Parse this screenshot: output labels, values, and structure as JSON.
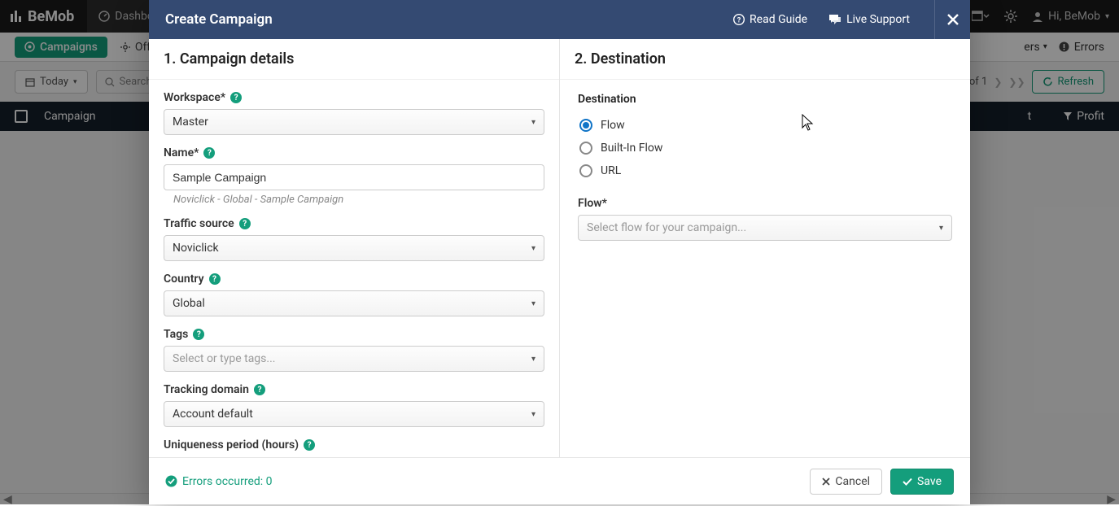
{
  "app": {
    "brand": "BeMob",
    "dashboard_tab": "Dashbo",
    "user_label": "Hi, BeMob"
  },
  "secondbar": {
    "campaigns": "Campaigns",
    "offers": "Offers",
    "ers_dropdown": "ers",
    "errors": "Errors"
  },
  "filterbar": {
    "today": "Today",
    "search_placeholder": "Search",
    "page_of": "of 1",
    "refresh": "Refresh"
  },
  "tablehead": {
    "campaign": "Campaign",
    "t_col": "t",
    "profit": "Profit"
  },
  "modal": {
    "title": "Create Campaign",
    "read_guide": "Read Guide",
    "live_support": "Live Support",
    "section1": "1. Campaign details",
    "section2": "2. Destination",
    "labels": {
      "workspace": "Workspace*",
      "name": "Name*",
      "traffic_source": "Traffic source",
      "country": "Country",
      "tags": "Tags",
      "tracking_domain": "Tracking domain",
      "uniqueness": "Uniqueness period (hours)"
    },
    "values": {
      "workspace": "Master",
      "name": "Sample Campaign",
      "name_sub": "Noviclick - Global - Sample Campaign",
      "traffic_source": "Noviclick",
      "country": "Global",
      "tags_placeholder": "Select or type tags...",
      "tracking_domain": "Account default"
    },
    "destination": {
      "header": "Destination",
      "flow": "Flow",
      "builtin": "Built-In Flow",
      "url": "URL",
      "flow_label": "Flow*",
      "flow_placeholder": "Select flow for your campaign..."
    },
    "footer": {
      "errors": "Errors occurred: 0",
      "cancel": "Cancel",
      "save": "Save"
    }
  }
}
